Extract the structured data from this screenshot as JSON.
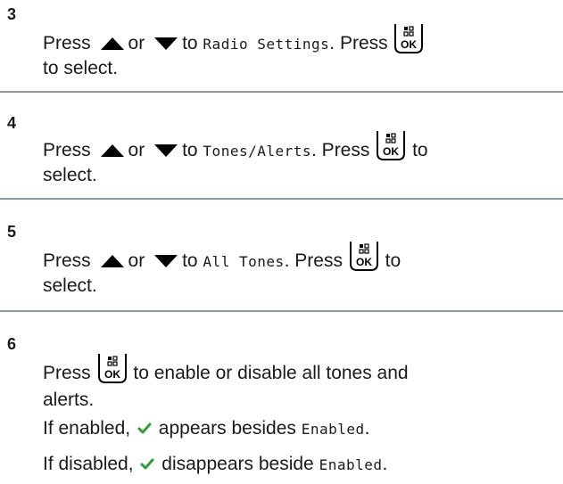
{
  "steps": [
    {
      "number": "3",
      "press": "Press",
      "or": "or",
      "to": "to",
      "menu_item": "Radio Settings",
      "press2": ". Press",
      "tail": "to select."
    },
    {
      "number": "4",
      "press": "Press",
      "or": "or",
      "to": "to",
      "menu_item": "Tones/Alerts",
      "press2": ". Press",
      "tail_inline": "to",
      "tail": "select."
    },
    {
      "number": "5",
      "press": "Press",
      "or": "or",
      "to": "to",
      "menu_item": "All Tones",
      "press2": ". Press",
      "tail_inline": "to",
      "tail": "select."
    },
    {
      "number": "6",
      "press": "Press",
      "action": "to enable or disable all tones and",
      "action_cont": "alerts.",
      "enabled_prefix": "If enabled,",
      "enabled_mid": "appears besides",
      "enabled_item": "Enabled",
      "enabled_end": ".",
      "disabled_prefix": "If disabled,",
      "disabled_mid": "disappears beside",
      "disabled_item": "Enabled",
      "disabled_end": "."
    }
  ],
  "icons": {
    "up": "up-arrow-icon",
    "down": "down-arrow-icon",
    "ok": "menu-ok-button-icon",
    "check": "checkmark-icon"
  },
  "colors": {
    "rule": "#8a9aa9",
    "check": "#2e9e3a"
  }
}
